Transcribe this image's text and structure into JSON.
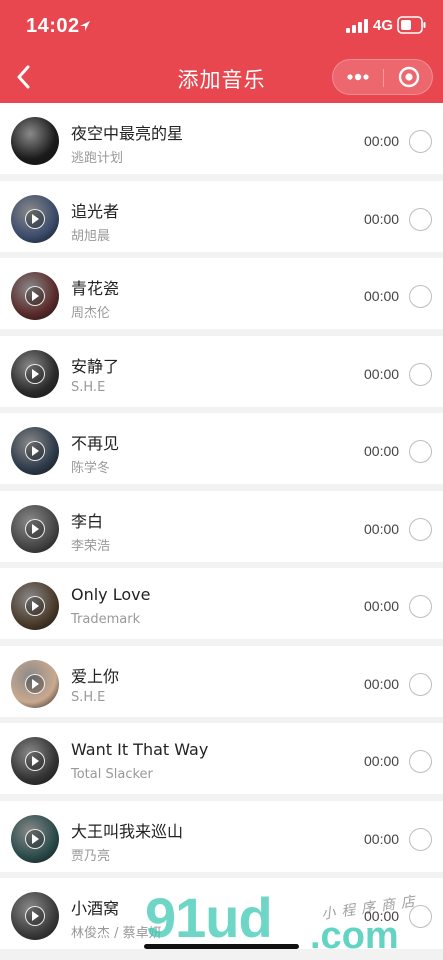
{
  "status_bar": {
    "time": "14:02",
    "network": "4G"
  },
  "nav": {
    "title": "添加音乐"
  },
  "songs": [
    {
      "title": "夜空中最亮的星",
      "artist": "逃跑计划",
      "duration": "00:00",
      "cover_color": "#1a1a1a",
      "has_play": false
    },
    {
      "title": "追光者",
      "artist": "胡旭晨",
      "duration": "00:00",
      "cover_color": "#3a4a6a",
      "has_play": true
    },
    {
      "title": "青花瓷",
      "artist": "周杰伦",
      "duration": "00:00",
      "cover_color": "#5a2a2a",
      "has_play": true
    },
    {
      "title": "安静了",
      "artist": "S.H.E",
      "duration": "00:00",
      "cover_color": "#2a2a2a",
      "has_play": true
    },
    {
      "title": "不再见",
      "artist": "陈学冬",
      "duration": "00:00",
      "cover_color": "#2d3a4a",
      "has_play": true
    },
    {
      "title": "李白",
      "artist": "李荣浩",
      "duration": "00:00",
      "cover_color": "#444444",
      "has_play": true
    },
    {
      "title": "Only Love",
      "artist": "Trademark",
      "duration": "00:00",
      "cover_color": "#4a3a2a",
      "has_play": true
    },
    {
      "title": "爱上你",
      "artist": "S.H.E",
      "duration": "00:00",
      "cover_color": "#c9a98f",
      "has_play": true
    },
    {
      "title": "Want It That Way",
      "artist": "Total Slacker",
      "duration": "00:00",
      "cover_color": "#333333",
      "has_play": true
    },
    {
      "title": "大王叫我来巡山",
      "artist": "贾乃亮",
      "duration": "00:00",
      "cover_color": "#2a4a4a",
      "has_play": true
    },
    {
      "title": "小酒窝",
      "artist": "林俊杰 / 蔡卓妍",
      "duration": "00:00",
      "cover_color": "#3a3a3a",
      "has_play": true
    }
  ],
  "watermark": {
    "logo_text": "91ud",
    "suffix": ".com",
    "tagline": "小程序商店"
  },
  "colors": {
    "header": "#e8474f",
    "background": "#f2f2f2"
  }
}
